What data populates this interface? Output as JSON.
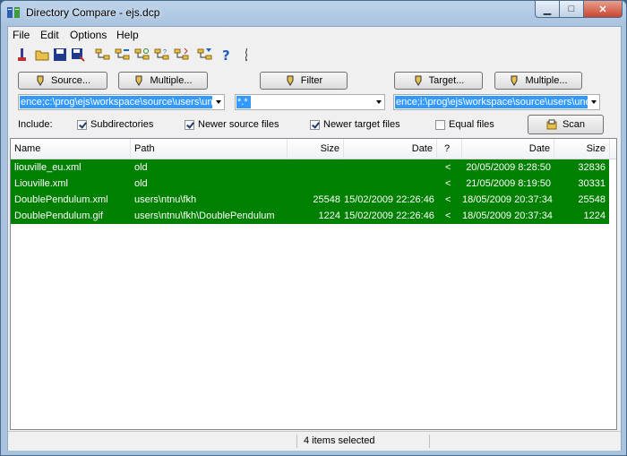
{
  "window": {
    "title": "Directory Compare - ejs.dcp",
    "min_glyph": "▁",
    "max_glyph": "□",
    "close_glyph": "✕"
  },
  "menu": [
    "File",
    "Edit",
    "Options",
    "Help"
  ],
  "toolbar_icons": [
    "wizard-icon",
    "open-folder-icon",
    "save-icon",
    "save-as-icon",
    "tree-compare-icon",
    "tree-left-icon",
    "tree-sync-icon",
    "tree-question-icon",
    "tree-right-icon",
    "tree-filter-icon",
    "help-icon",
    "info-icon"
  ],
  "buttons": {
    "source": "Source...",
    "multiple_left": "Multiple...",
    "filter": "Filter",
    "target": "Target...",
    "multiple_right": "Multiple...",
    "scan": "Scan"
  },
  "paths": {
    "source": "ence;c:\\prog\\ejs\\workspace\\source\\users\\uned",
    "filter": "*.*",
    "target": "ence;i:\\prog\\ejs\\workspace\\source\\users\\uned"
  },
  "include": {
    "label": "Include:",
    "subdirectories": "Subdirectories",
    "newer_source": "Newer source files",
    "newer_target": "Newer target files",
    "equal": "Equal files"
  },
  "columns": {
    "name": "Name",
    "path": "Path",
    "size": "Size",
    "date": "Date",
    "q": "?",
    "date2": "Date",
    "size2": "Size"
  },
  "rows": [
    {
      "name": "liouville_eu.xml",
      "path": "old",
      "size": "",
      "date": "",
      "q": "<",
      "date2": "20/05/2009 8:28:50",
      "size2": "32836"
    },
    {
      "name": "Liouville.xml",
      "path": "old",
      "size": "",
      "date": "",
      "q": "<",
      "date2": "21/05/2009 8:19:50",
      "size2": "30331"
    },
    {
      "name": "DoublePendulum.xml",
      "path": "users\\ntnu\\fkh",
      "size": "25548",
      "date": "15/02/2009 22:26:46",
      "q": "<",
      "date2": "18/05/2009 20:37:34",
      "size2": "25548"
    },
    {
      "name": "DoublePendulum.gif",
      "path": "users\\ntnu\\fkh\\DoublePendulum",
      "size": "1224",
      "date": "15/02/2009 22:26:46",
      "q": "<",
      "date2": "18/05/2009 20:37:34",
      "size2": "1224"
    }
  ],
  "status": "4 items selected",
  "colors": {
    "row_bg": "#008000",
    "selection": "#3399ff"
  }
}
